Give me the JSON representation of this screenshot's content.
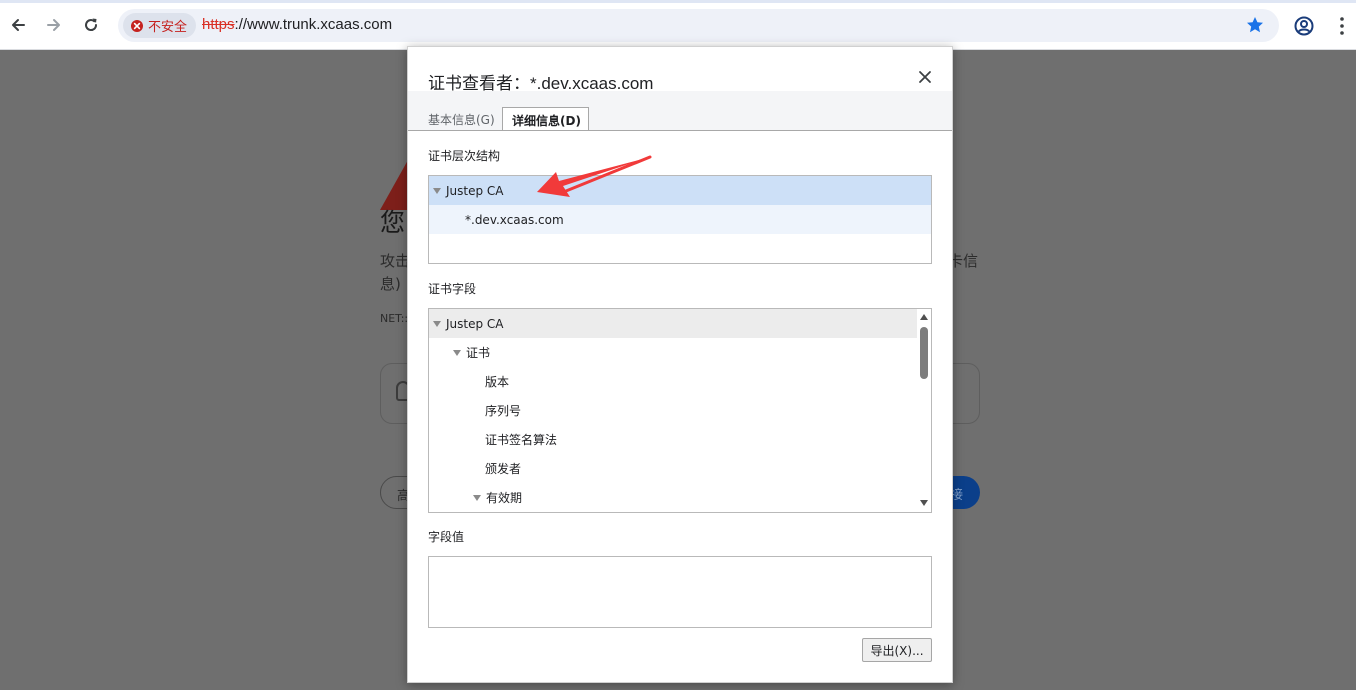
{
  "browser": {
    "security_label": "不安全",
    "url_scheme": "https",
    "url_rest": "://www.trunk.xcaas.com"
  },
  "background_page": {
    "title": "您",
    "line1": "攻击",
    "line1_tail": "卡信",
    "line2": "息)",
    "code": "NET::",
    "button_left": "高",
    "button_right": "接"
  },
  "dialog": {
    "title": "证书查看者：*.dev.xcaas.com",
    "tabs": [
      {
        "label": "基本信息(G)",
        "active": false
      },
      {
        "label": "详细信息(D)",
        "active": true
      }
    ],
    "hierarchy_label": "证书层次结构",
    "hierarchy": [
      {
        "label": "Justep CA",
        "selected": true,
        "expanded": true
      },
      {
        "label": "*.dev.xcaas.com",
        "selected": false
      }
    ],
    "fields_label": "证书字段",
    "fields": [
      {
        "label": "Justep CA",
        "expanded": true
      },
      {
        "label": "证书",
        "expanded": true
      },
      {
        "label": "版本"
      },
      {
        "label": "序列号"
      },
      {
        "label": "证书签名算法"
      },
      {
        "label": "颁发者"
      },
      {
        "label": "有效期",
        "expanded": true
      }
    ],
    "field_value_label": "字段值",
    "field_value": "",
    "export_label": "导出(X)..."
  },
  "colors": {
    "accent": "#1a73e8",
    "danger": "#d93025",
    "selection": "#cde0f7",
    "annotation_arrow": "#f13a3a"
  }
}
